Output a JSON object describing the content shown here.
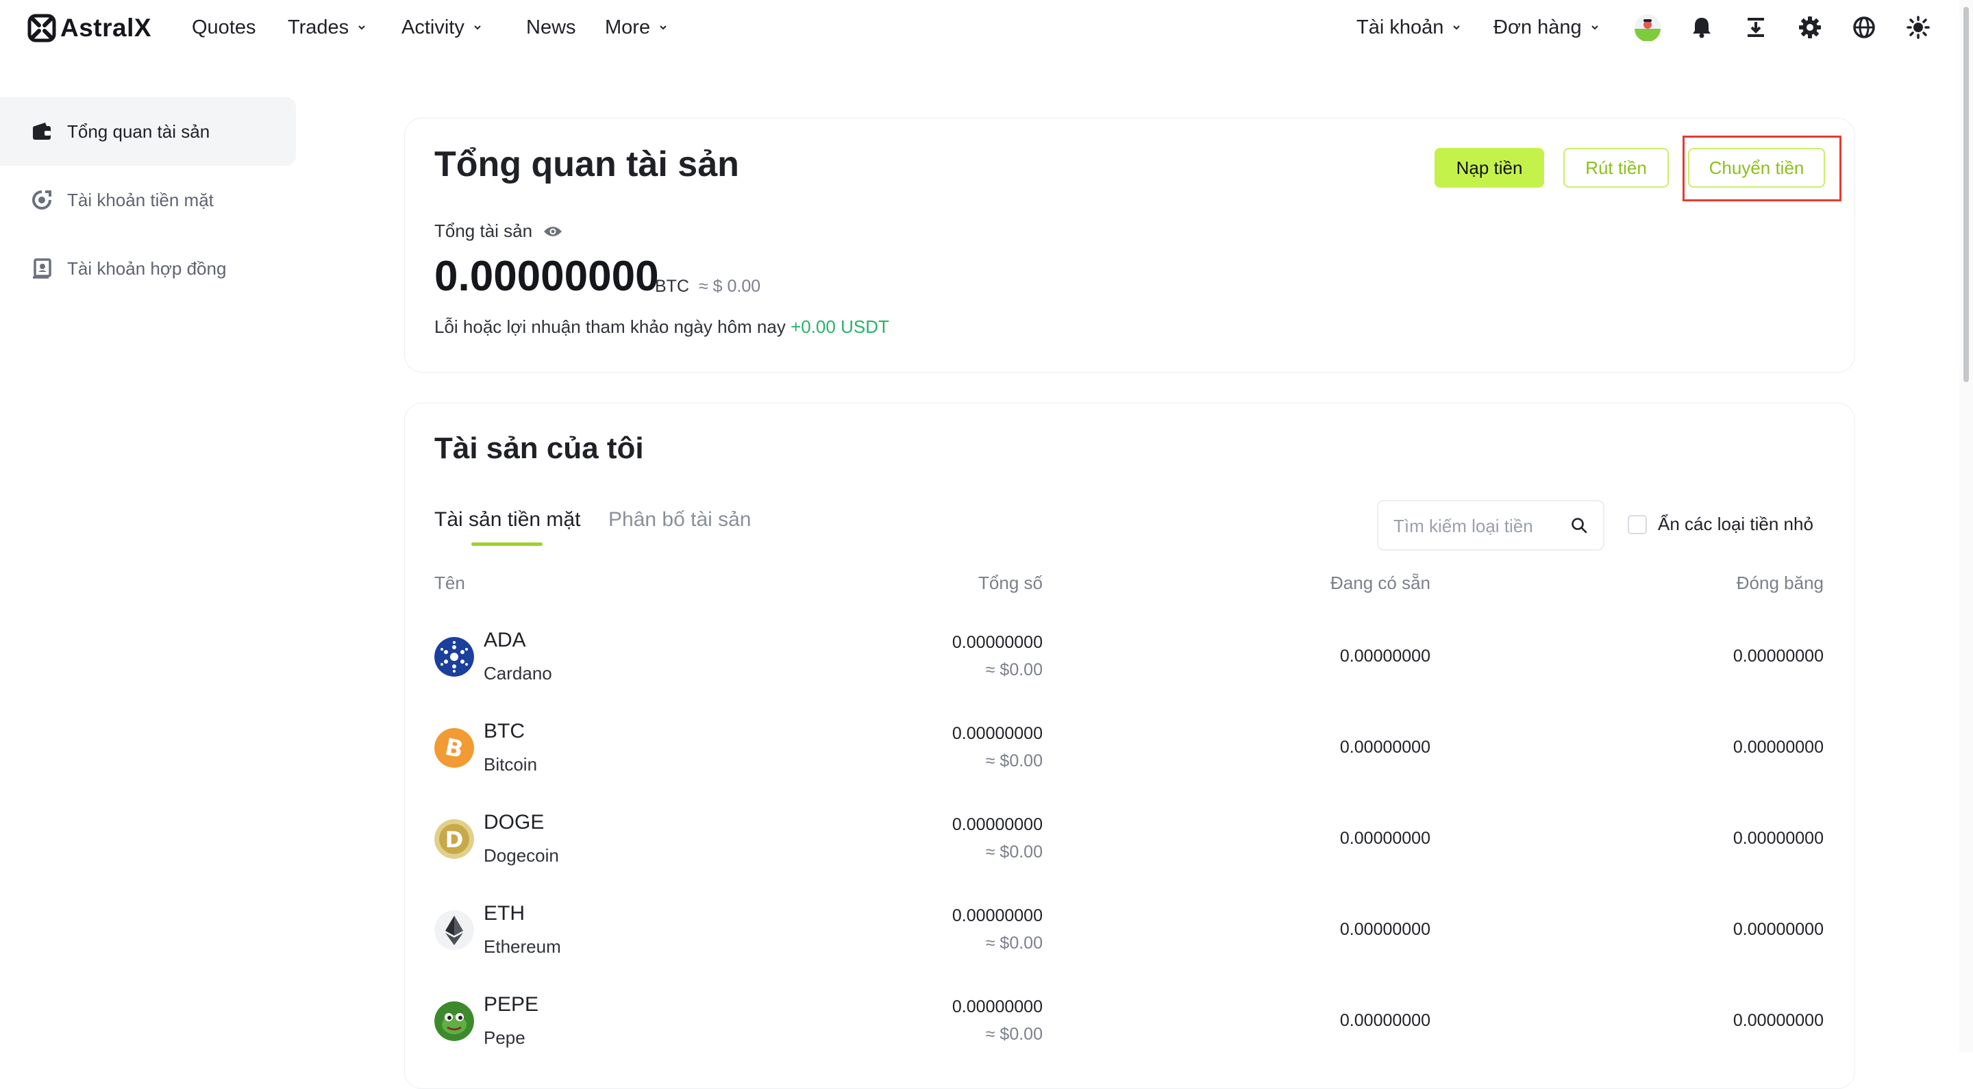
{
  "nav": {
    "logo_text": "AstralX",
    "items": [
      {
        "label": "Quotes"
      },
      {
        "label": "Trades"
      },
      {
        "label": "Activity"
      },
      {
        "label": "News"
      },
      {
        "label": "More"
      }
    ],
    "account_label": "Tài khoản",
    "orders_label": "Đơn hàng",
    "icons": [
      "avatar",
      "bell-icon",
      "download-icon",
      "gear-icon",
      "globe-icon",
      "sun-icon"
    ]
  },
  "sidebar": {
    "items": [
      {
        "label": "Tổng quan tài sản",
        "icon": "wallet-icon",
        "active": true
      },
      {
        "label": "Tài khoản tiền mặt",
        "icon": "cash-account-icon",
        "active": false
      },
      {
        "label": "Tài khoản hợp đồng",
        "icon": "contract-account-icon",
        "active": false
      }
    ]
  },
  "overview": {
    "title": "Tổng quan tài sản",
    "deposit_label": "Nạp tiền",
    "withdraw_label": "Rút tiền",
    "transfer_label": "Chuyển tiền",
    "total_label": "Tổng tài sản",
    "total_value": "0.00000000",
    "total_unit": "BTC",
    "total_usd": "≈ $ 0.00",
    "pnl_label": "Lỗi hoặc lợi nhuận tham khảo ngày hôm nay",
    "pnl_value": "+0.00 USDT"
  },
  "assets": {
    "title": "Tài sản của tôi",
    "tabs": [
      {
        "label": "Tài sản tiền mặt",
        "active": true
      },
      {
        "label": "Phân bố tài sản",
        "active": false
      }
    ],
    "search_placeholder": "Tìm kiếm loại tiền",
    "hide_small_label": "Ẩn các loại tiền nhỏ",
    "columns": {
      "name": "Tên",
      "total": "Tổng số",
      "available": "Đang có sẵn",
      "frozen": "Đóng băng"
    },
    "rows": [
      {
        "symbol": "ADA",
        "name": "Cardano",
        "total": "0.00000000",
        "total_usd": "≈ $0.00",
        "available": "0.00000000",
        "frozen": "0.00000000",
        "icon": "cardano-icon"
      },
      {
        "symbol": "BTC",
        "name": "Bitcoin",
        "total": "0.00000000",
        "total_usd": "≈ $0.00",
        "available": "0.00000000",
        "frozen": "0.00000000",
        "icon": "bitcoin-icon"
      },
      {
        "symbol": "DOGE",
        "name": "Dogecoin",
        "total": "0.00000000",
        "total_usd": "≈ $0.00",
        "available": "0.00000000",
        "frozen": "0.00000000",
        "icon": "dogecoin-icon"
      },
      {
        "symbol": "ETH",
        "name": "Ethereum",
        "total": "0.00000000",
        "total_usd": "≈ $0.00",
        "available": "0.00000000",
        "frozen": "0.00000000",
        "icon": "ethereum-icon"
      },
      {
        "symbol": "PEPE",
        "name": "Pepe",
        "total": "0.00000000",
        "total_usd": "≈ $0.00",
        "available": "0.00000000",
        "frozen": "0.00000000",
        "icon": "pepe-icon"
      }
    ]
  },
  "colors": {
    "accent": "#c5f24a",
    "accent_text": "#8ac019",
    "positive": "#26b36a",
    "highlight": "#e53b2f"
  }
}
